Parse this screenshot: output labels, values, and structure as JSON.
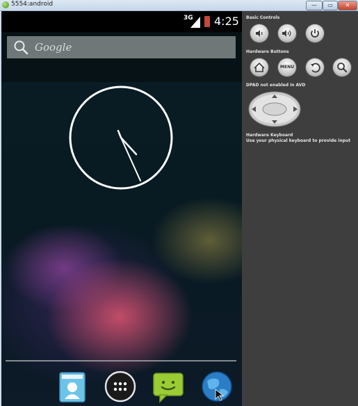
{
  "window": {
    "title": "5554:android",
    "min_symbol": "—",
    "max_symbol": "▭",
    "close_symbol": "✕"
  },
  "status_bar": {
    "network": "3G",
    "time": "4:25"
  },
  "search": {
    "placeholder": "Google"
  },
  "controls": {
    "basic_controls_label": "Basic Controls",
    "hardware_buttons_label": "Hardware Buttons",
    "menu_label": "MENU",
    "dpad_label": "DPAD not enabled in AVD",
    "keyboard_label": "Hardware Keyboard",
    "keyboard_hint": "Use your physical keyboard to provide input"
  },
  "colors": {
    "controls_panel": "#3e3e3e",
    "statusbar": "#000000",
    "search_bar": "#6f7779",
    "battery": "#c24a3a"
  },
  "icons": [
    "volume-down-icon",
    "volume-up-icon",
    "power-icon",
    "home-icon",
    "menu-icon",
    "back-icon",
    "search-icon",
    "dpad-icon",
    "contacts-icon",
    "apps-drawer-icon",
    "messaging-icon",
    "browser-icon"
  ]
}
